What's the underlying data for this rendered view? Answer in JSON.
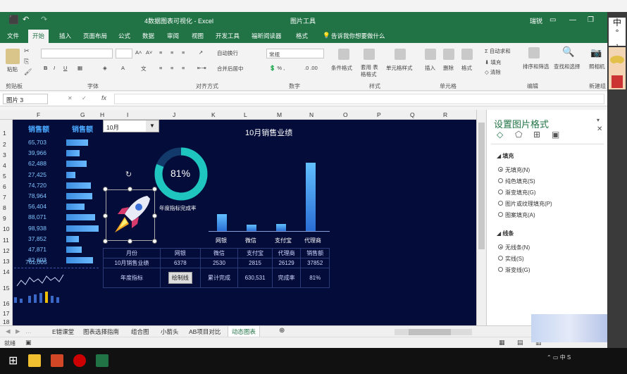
{
  "window": {
    "title": "4数据图表可视化 - Excel",
    "context_tab": "图片工具",
    "user": "瑞锐"
  },
  "menu": [
    "文件",
    "开始",
    "插入",
    "页面布局",
    "公式",
    "数据",
    "审阅",
    "视图",
    "开发工具",
    "福昕阅读器",
    "格式"
  ],
  "tell_me": "告诉我你想要做什么",
  "ribbon": {
    "paste": "粘贴",
    "clipboard": "剪贴板",
    "font": "字体",
    "align": "对齐方式",
    "number": "数字",
    "styles": "样式",
    "cells": "单元格",
    "editing": "编辑",
    "new": "新建组",
    "wrap": "自动换行",
    "merge": "合并后居中",
    "general": "常规",
    "cond_format": "条件格式",
    "table_format": "套用\n表格格式",
    "cell_style": "单元格样式",
    "insert": "插入",
    "delete": "删除",
    "format": "格式",
    "autosum": "自动求和",
    "fill": "填充",
    "clear": "清除",
    "sort": "排序和筛选",
    "find": "查找和选择",
    "photo": "照相机"
  },
  "name_box": "图片 3",
  "fx": "fx",
  "col_headers": [
    "F",
    "G",
    "H",
    "I",
    "J",
    "K",
    "L",
    "M",
    "N",
    "O",
    "P",
    "Q",
    "R"
  ],
  "row_headers": [
    "1",
    "2",
    "3",
    "4",
    "5",
    "6",
    "7",
    "8",
    "9",
    "10",
    "11",
    "12",
    "13",
    "14",
    "15",
    "16",
    "17",
    "18"
  ],
  "dashboard": {
    "sales_header_1": "销售额",
    "sales_header_2": "销售额",
    "sales": [
      "65,703",
      "39,966",
      "62,488",
      "27,425",
      "74,720",
      "78,964",
      "56,404",
      "88,071",
      "98,938",
      "37,852",
      "47,871",
      "82,603"
    ],
    "sales_bar_fraction": [
      0.664,
      0.404,
      0.632,
      0.277,
      0.755,
      0.798,
      0.57,
      0.89,
      1.0,
      0.383,
      0.484,
      0.835
    ],
    "total": "761,005",
    "month_select": "10月",
    "chart_title": "10月销售业绩",
    "donut_label": "81%",
    "donut_value": 0.81,
    "donut_caption": "年度指标完成率"
  },
  "chart_data": {
    "type": "bar",
    "title": "10月销售业绩",
    "categories": [
      "网银",
      "微信",
      "支付宝",
      "代理商"
    ],
    "values": [
      6378,
      2530,
      2815,
      26129
    ],
    "ylim": [
      0,
      28000
    ]
  },
  "table": {
    "header": [
      "月份",
      "网银",
      "微信",
      "支付宝",
      "代理商",
      "销售额"
    ],
    "row1": [
      "10月销售业绩",
      "6378",
      "2530",
      "2815",
      "26129",
      "37852"
    ],
    "row2": [
      "年度指标",
      "",
      "累计完成",
      "630,531",
      "完成率",
      "81%"
    ],
    "btn": "绘制线"
  },
  "pane": {
    "title": "设置图片格式",
    "fill_section": "填充",
    "fill_opts": [
      "无填充(N)",
      "纯色填充(S)",
      "渐变填充(G)",
      "图片或纹理填充(P)",
      "图案填充(A)"
    ],
    "line_section": "线条",
    "line_opts": [
      "无线条(N)",
      "实线(S)",
      "渐变线(G)"
    ]
  },
  "sheet_tabs": [
    "E错课堂",
    "图表选择指南",
    "组合图",
    "小箭头",
    "AB项目对比",
    "动态图表"
  ],
  "status": "就绪",
  "colors": {
    "excel_green": "#217346",
    "dashboard_bg": "#040c3a",
    "accent": "#1fc6c0"
  }
}
